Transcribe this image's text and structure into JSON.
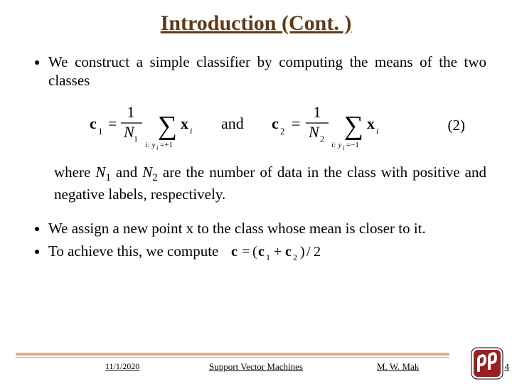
{
  "title": "Introduction (Cont. )",
  "bullets": {
    "b1": "We construct a simple classifier by computing the means of the two classes",
    "b2": "We assign a new point x to the class whose mean is closer to it.",
    "b3": "To achieve this, we compute"
  },
  "where_pre": "where ",
  "where_n1": "N",
  "where_sub1": "1",
  "where_mid1": " and ",
  "where_n2": "N",
  "where_sub2": "2",
  "where_post": " are the number of data in the class with positive and negative labels, respectively.",
  "eq_label": "(2)",
  "footer": {
    "date": "11/1/2020",
    "center": "Support Vector Machines",
    "author": "M. W. Mak",
    "page": "4"
  },
  "chart_data": {
    "type": "table",
    "description": "Mathematical definitions on the slide",
    "equations": [
      {
        "label": "(2)",
        "lhs": "c1",
        "rhs": "(1/N1) * sum over i where y_i=+1 of x_i"
      },
      {
        "label": "(2)",
        "lhs": "c2",
        "rhs": "(1/N2) * sum over i where y_i=-1 of x_i"
      },
      {
        "label": "",
        "lhs": "c",
        "rhs": "(c1 + c2) / 2"
      }
    ]
  }
}
